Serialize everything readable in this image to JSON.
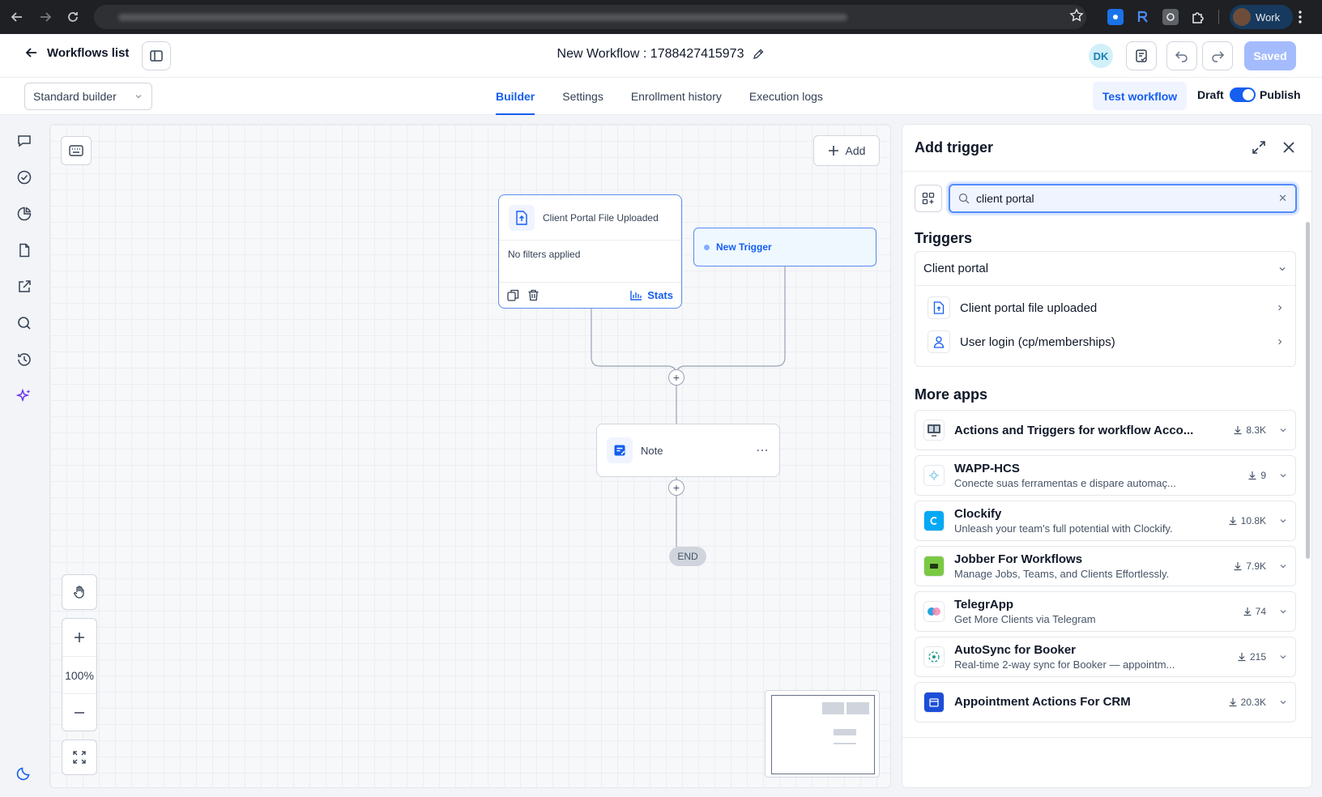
{
  "browser": {
    "profile_name": "Work"
  },
  "header": {
    "back_label": "Workflows list",
    "workflow_title": "New Workflow : 1788427415973",
    "avatar_initials": "DK",
    "saved_label": "Saved"
  },
  "subheader": {
    "builder_mode": "Standard builder",
    "tabs": [
      {
        "label": "Builder",
        "active": true
      },
      {
        "label": "Settings",
        "active": false
      },
      {
        "label": "Enrollment history",
        "active": false
      },
      {
        "label": "Execution logs",
        "active": false
      }
    ],
    "test_workflow_label": "Test workflow",
    "draft_label": "Draft",
    "publish_label": "Publish",
    "publish_on": true
  },
  "canvas": {
    "add_label": "Add",
    "trigger_node": {
      "title": "Client Portal File Uploaded",
      "filters_text": "No filters applied",
      "stats_label": "Stats"
    },
    "new_trigger_label": "New Trigger",
    "note_label": "Note",
    "end_label": "END",
    "zoom_level": "100%"
  },
  "panel": {
    "title": "Add trigger",
    "search_value": "client portal",
    "triggers_heading": "Triggers",
    "category": "Client portal",
    "trigger_items": [
      {
        "label": "Client portal file uploaded",
        "icon": "file-upload-icon"
      },
      {
        "label": "User login (cp/memberships)",
        "icon": "user-icon"
      }
    ],
    "more_apps_heading": "More apps",
    "apps": [
      {
        "name": "Actions and Triggers for workflow Acco...",
        "desc": "",
        "downloads": "8.3K",
        "logo": "monitor-logo",
        "logo_color": "#4b5563"
      },
      {
        "name": "WAPP-HCS",
        "desc": "Conecte suas ferramentas e dispare automaç...",
        "downloads": "9",
        "logo": "wapp-logo",
        "logo_color": "#7cc7e8"
      },
      {
        "name": "Clockify",
        "desc": "Unleash your team's full potential with Clockify.",
        "downloads": "10.8K",
        "logo": "clockify-logo",
        "logo_color": "#03a9f4"
      },
      {
        "name": "Jobber For Workflows",
        "desc": "Manage Jobs, Teams, and Clients Effortlessly.",
        "downloads": "7.9K",
        "logo": "jobber-logo",
        "logo_color": "#7ac943"
      },
      {
        "name": "TelegrApp",
        "desc": "Get More Clients via Telegram",
        "downloads": "74",
        "logo": "telegrapp-logo",
        "logo_color": "#2aa3e0"
      },
      {
        "name": "AutoSync for Booker",
        "desc": "Real-time 2-way sync for Booker — appointm...",
        "downloads": "215",
        "logo": "autosync-logo",
        "logo_color": "#1a9b8c"
      },
      {
        "name": "Appointment Actions For CRM",
        "desc": "",
        "downloads": "20.3K",
        "logo": "appointment-logo",
        "logo_color": "#1d4ed8"
      }
    ]
  }
}
